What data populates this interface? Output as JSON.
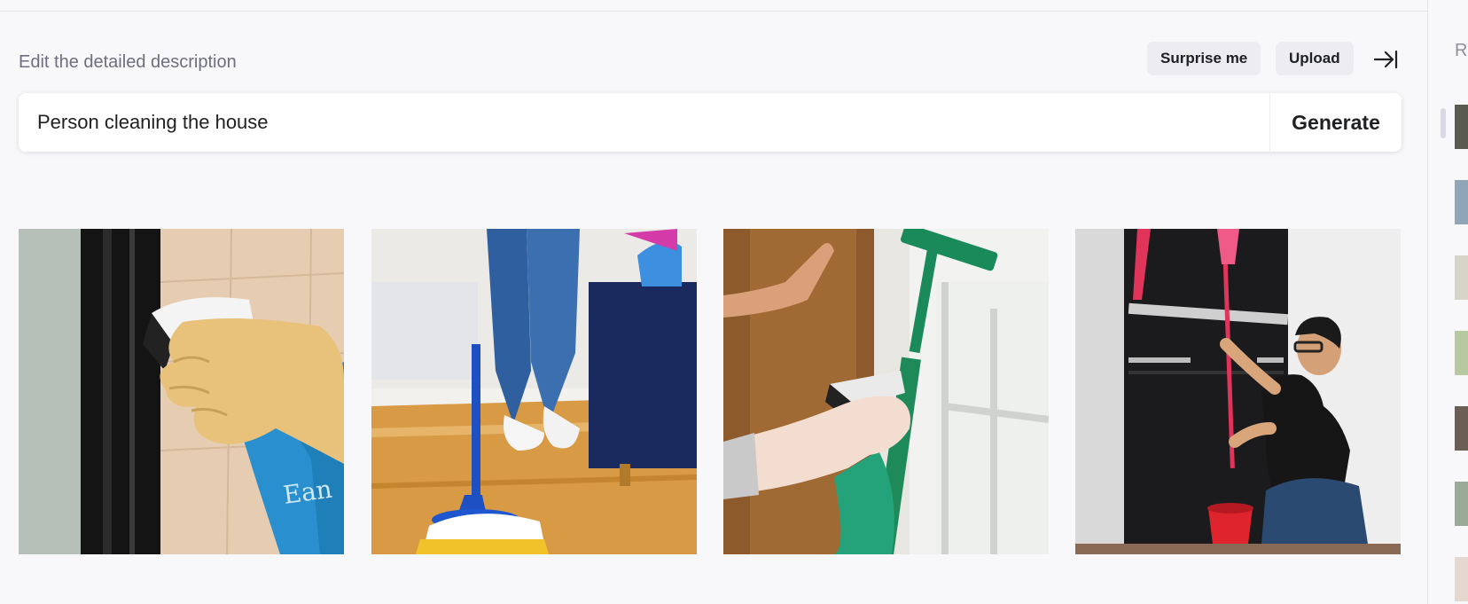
{
  "header": {
    "description_label": "Edit the detailed description",
    "surprise_label": "Surprise me",
    "upload_label": "Upload",
    "collapse_icon": "arrow-right-to-line-icon"
  },
  "prompt": {
    "value": "Person cleaning the house",
    "generate_label": "Generate"
  },
  "results": [
    {
      "name": "cleaning-spray-glove-image"
    },
    {
      "name": "mopping-floor-image"
    },
    {
      "name": "squeegee-window-image"
    },
    {
      "name": "man-cleaning-fridge-image"
    }
  ],
  "sidebar": {
    "title": "R",
    "thumbnail_count": 7
  },
  "colors": {
    "background": "#f8f8fa",
    "pill": "#ececf1",
    "text": "#202123",
    "muted": "#6e6e80"
  }
}
